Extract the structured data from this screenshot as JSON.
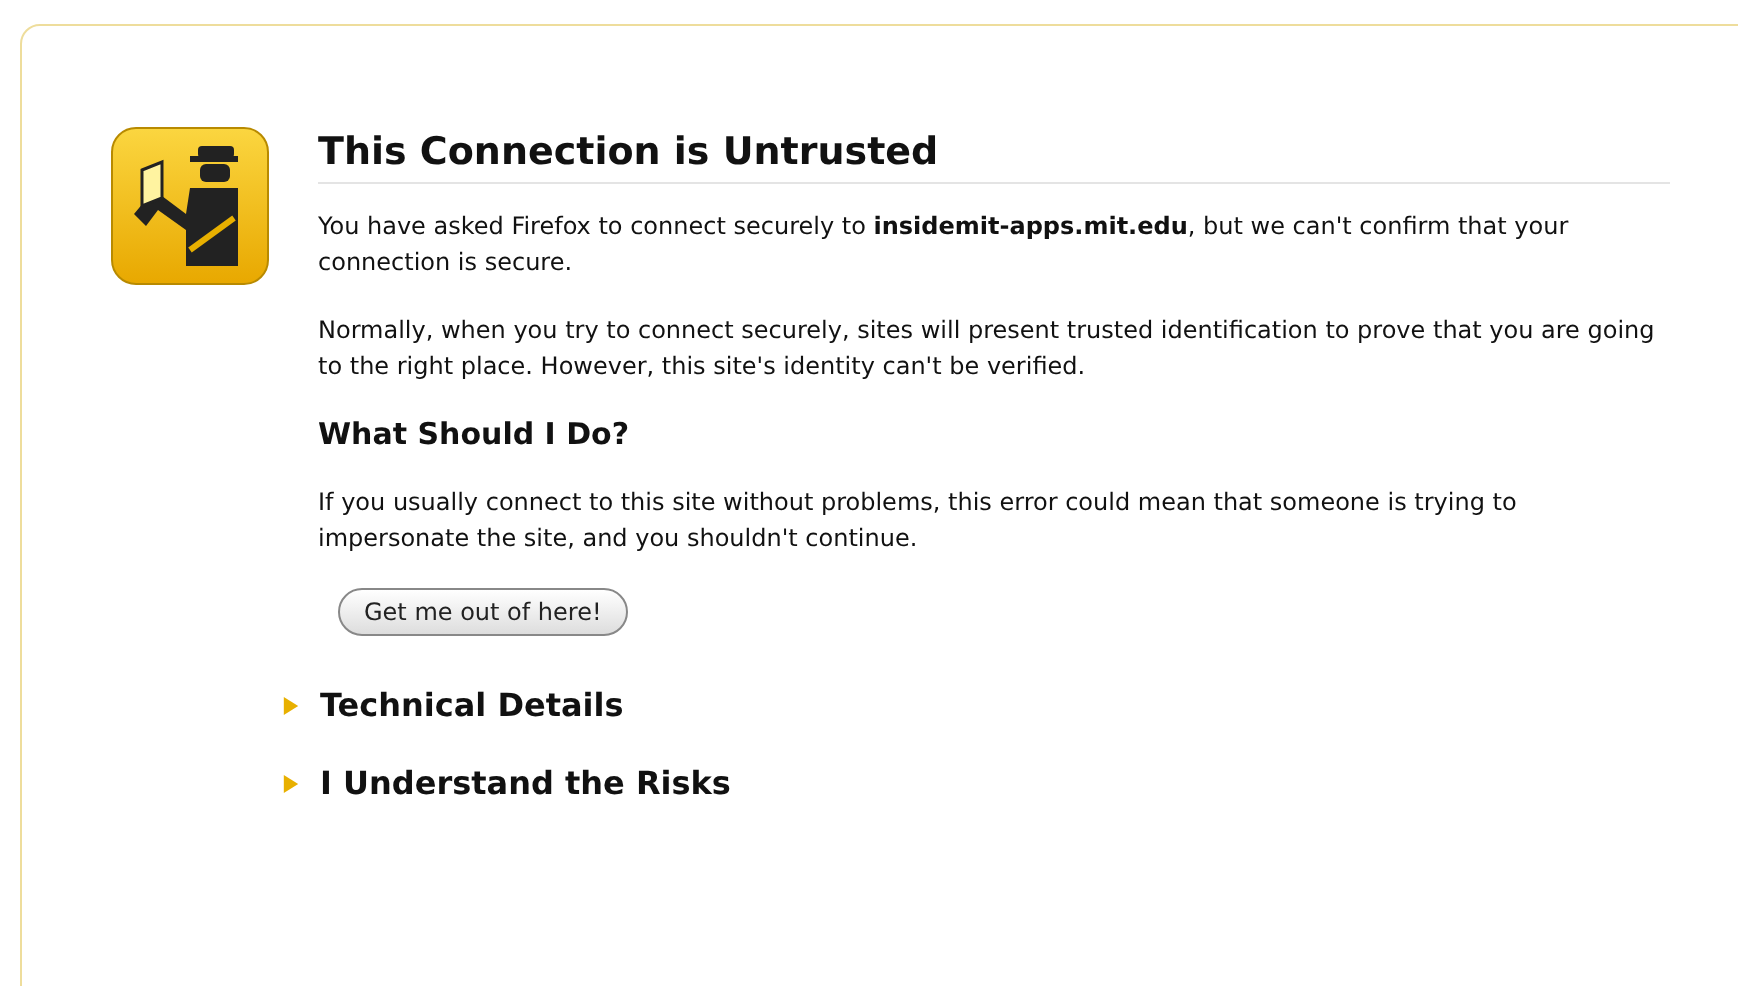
{
  "title": "This Connection is Untrusted",
  "intro": "You have asked Firefox to connect securely to **insidemit-apps.mit.edu**, but we can't confirm that your connection is secure.",
  "explanation": "Normally, when you try to connect securely, sites will present trusted identification to prove that you are going to the right place. However, this site's identity can't be verified.",
  "advice_heading": "What Should I Do?",
  "advice": "If you usually connect to this site without problems, this error could mean that someone is trying to impersonate the site, and you shouldn't continue.",
  "button": "Get me out of here!",
  "sections": [
    {
      "label": "Technical Details",
      "expanded": false
    },
    {
      "label": "I Understand the Risks",
      "expanded": false
    }
  ]
}
